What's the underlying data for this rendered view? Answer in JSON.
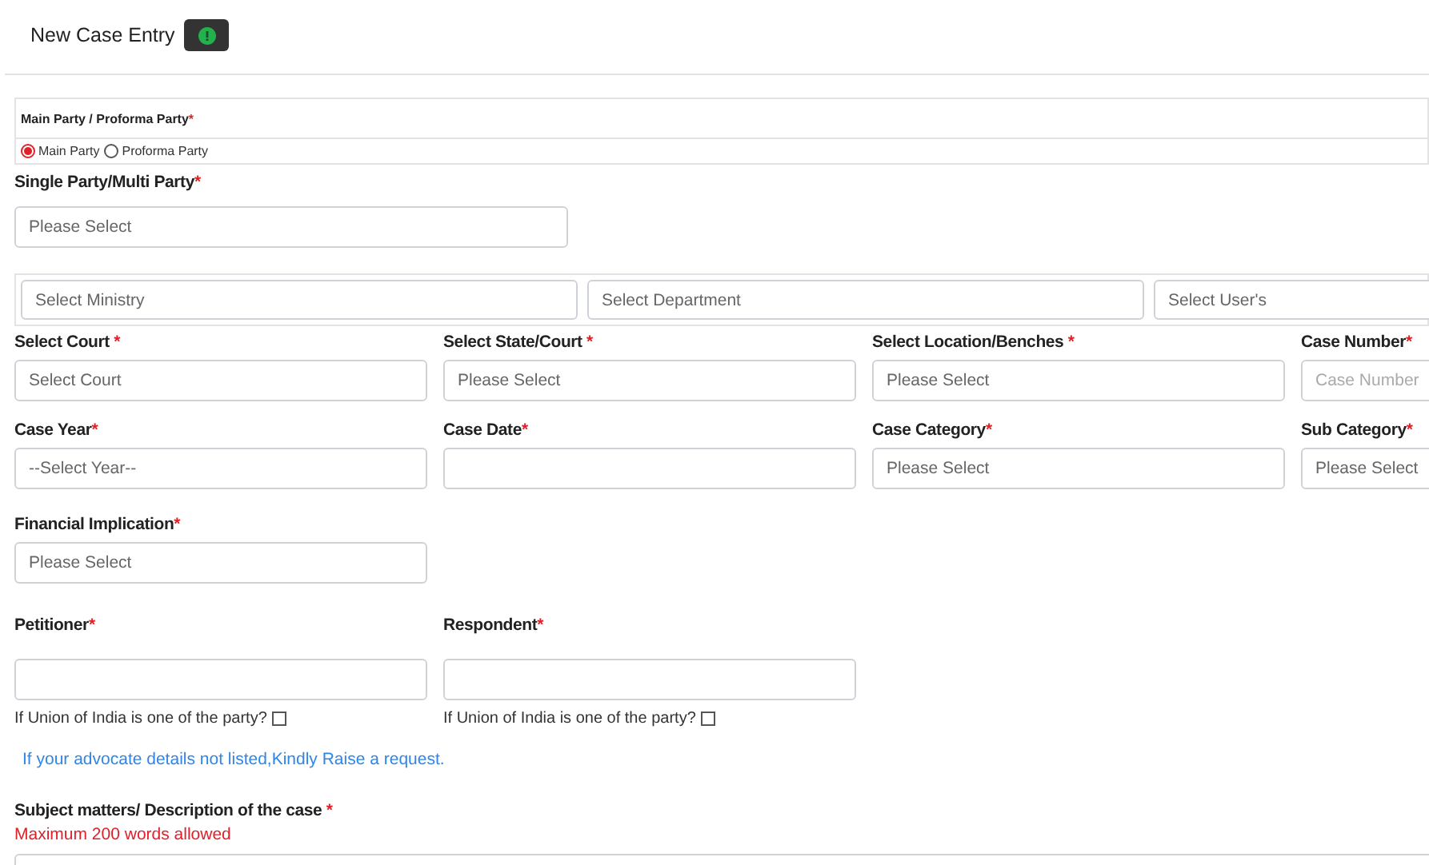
{
  "header": {
    "title": "New Case Entry"
  },
  "party_type": {
    "label": "Main Party / Proforma Party",
    "mark": "*",
    "options": [
      {
        "label": "Main Party",
        "selected": true
      },
      {
        "label": "Proforma Party",
        "selected": false
      }
    ]
  },
  "party_count": {
    "label": "Single Party/Multi Party",
    "mark": "*",
    "placeholder": "Please Select"
  },
  "org_selects": [
    {
      "placeholder": "Select Ministry"
    },
    {
      "placeholder": "Select Department"
    },
    {
      "placeholder": "Select User's"
    }
  ],
  "field_rows": [
    [
      {
        "label": "Select Court",
        "mark": " *",
        "placeholder": "Select Court"
      },
      {
        "label": "Select State/Court",
        "mark": " *",
        "placeholder": "Please Select"
      },
      {
        "label": "Select Location/Benches",
        "mark": " *",
        "placeholder": "Please Select"
      },
      {
        "label": "Case Number",
        "mark": "*",
        "placeholder": "Case Number",
        "kind": "text"
      }
    ],
    [
      {
        "label": "Case Year",
        "mark": "*",
        "placeholder": "--Select Year--"
      },
      {
        "label": "Case Date",
        "mark": "*"
      },
      {
        "label": "Case Category",
        "mark": "*",
        "placeholder": "Please Select"
      },
      {
        "label": "Sub Category",
        "mark": "*",
        "placeholder": "Please Select"
      }
    ],
    [
      {
        "label": "Financial Implication",
        "mark": "*",
        "placeholder": "Please Select"
      }
    ]
  ],
  "parties": [
    {
      "label": "Petitioner",
      "mark": "*",
      "note": "If Union of India is one of the party?",
      "checked": false
    },
    {
      "label": "Respondent",
      "mark": "*",
      "note": "If Union of India is one of the party?",
      "checked": false
    }
  ],
  "advocate_link": "If your advocate details not listed,Kindly Raise a request.",
  "description": {
    "label": "Subject matters/ Description of the case",
    "mark": " *",
    "hint": "Maximum 200 words allowed"
  }
}
